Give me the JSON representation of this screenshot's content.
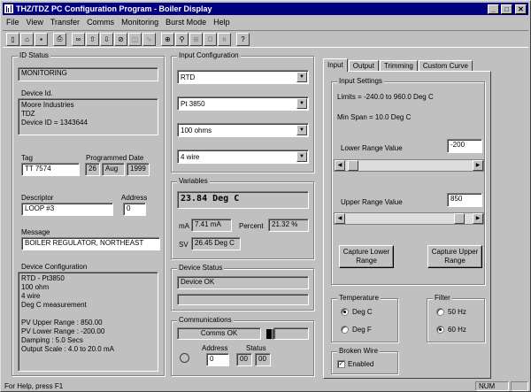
{
  "window": {
    "title": "THZ/TDZ PC Configuration Program - Boiler Display"
  },
  "menu": [
    "File",
    "View",
    "Transfer",
    "Comms",
    "Monitoring",
    "Burst Mode",
    "Help"
  ],
  "toolbar_icons": [
    "new-icon",
    "open-icon",
    "save-icon",
    "print-icon",
    "loop-icon",
    "upload-icon",
    "download-icon",
    "stop-icon",
    "trim-icon",
    "wave-icon",
    "capture-icon",
    "range-icon",
    "sensor-icon",
    "resistance-icon",
    "help-icon"
  ],
  "id_status": {
    "title": "ID Status",
    "status": "MONITORING",
    "device_id_label": "Device Id.",
    "device_id_text": "Moore Industries\nTDZ\nDevice ID = 1343644",
    "tag_label": "Tag",
    "tag_value": "TT 7574",
    "programmed_date_label": "Programmed Date",
    "date_day": "26",
    "date_month": "Aug",
    "date_year": "1999",
    "descriptor_label": "Descriptor",
    "descriptor_value": "LOOP #3",
    "address_label": "Address",
    "address_value": "0",
    "message_label": "Message",
    "message_value": "BOILER REGULATOR, NORTHEAST",
    "device_config_label": "Device Configuration",
    "device_config_text": "RTD - Pt3850\n100 ohm\n4 wire\nDeg C measurement\n\nPV Upper Range : 850.00\nPV Lower Range : -200.00\nDamping : 5.0 Secs\nOutput Scale : 4.0 to 20.0 mA"
  },
  "input_config": {
    "title": "Input Configuration",
    "sensor_type": "RTD",
    "sensor_element": "Pt 3850",
    "resistance": "100 ohms",
    "wiring": "4 wire"
  },
  "variables": {
    "title": "Variables",
    "pv": "23.84 Deg C",
    "ma_label": "mA",
    "ma_value": "7.41 mA",
    "percent_label": "Percent",
    "percent_value": "21.32 %",
    "sv_label": "SV",
    "sv_value": "26.45 Deg C"
  },
  "device_status": {
    "title": "Device Status",
    "status": "Device OK",
    "status2": ""
  },
  "communications": {
    "title": "Communications",
    "status": "Comms OK",
    "address_label": "Address",
    "address_value": "0",
    "status_label": "Status",
    "status_byte1": "00",
    "status_byte2": "00"
  },
  "tabs": [
    "Input",
    "Output",
    "Trimming",
    "Custom Curve"
  ],
  "input_settings": {
    "title": "Input Settings",
    "limits": "Limits = -240.0 to 960.0 Deg C",
    "min_span": "Min Span = 10.0 Deg C",
    "lower_label": "Lower Range Value",
    "lower_value": "-200",
    "lower_slider_fraction": 0.02,
    "upper_label": "Upper Range Value",
    "upper_value": "850",
    "upper_slider_fraction": 0.93,
    "capture_lower": "Capture Lower Range",
    "capture_upper": "Capture Upper Range"
  },
  "temperature": {
    "title": "Temperature",
    "options": [
      "Deg C",
      "Deg F"
    ],
    "selected": "Deg C"
  },
  "filter": {
    "title": "Filter",
    "options": [
      "50 Hz",
      "60 Hz"
    ],
    "selected": "60 Hz"
  },
  "broken_wire": {
    "title": "Broken Wire",
    "label": "Enabled",
    "checked": true
  },
  "statusbar": {
    "help": "For Help, press F1",
    "num": "NUM"
  }
}
